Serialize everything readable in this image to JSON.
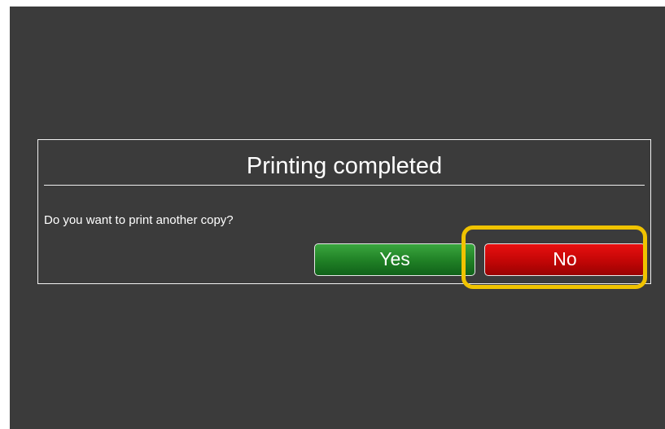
{
  "dialog": {
    "title": "Printing completed",
    "message": "Do you want to print another copy?",
    "yes_label": "Yes",
    "no_label": "No"
  },
  "colors": {
    "background": "#3b3b3b",
    "yes_button": "#1f7f25",
    "no_button": "#c20606",
    "highlight": "#f0c300"
  }
}
